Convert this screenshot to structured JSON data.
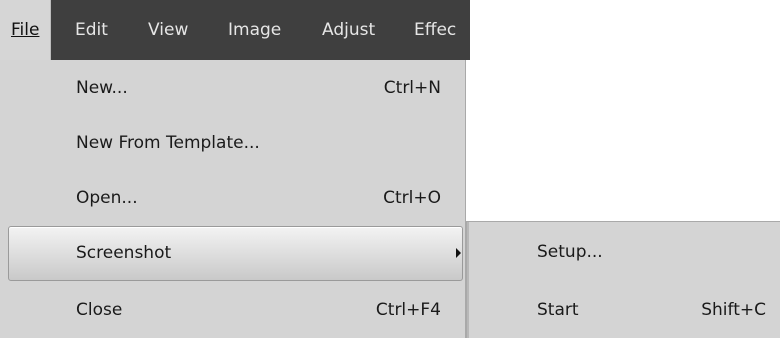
{
  "menubar": {
    "items": [
      {
        "label": "File",
        "underline": "F"
      },
      {
        "label": "Edit",
        "underline": "E"
      },
      {
        "label": "View",
        "underline": "V"
      },
      {
        "label": "Image",
        "underline": "I"
      },
      {
        "label": "Adjust",
        "underline": "A"
      },
      {
        "label": "Effec"
      }
    ],
    "active": "File"
  },
  "file_menu": {
    "items": [
      {
        "label": "New...",
        "shortcut": "Ctrl+N"
      },
      {
        "label": "New From Template...",
        "shortcut": ""
      },
      {
        "label": "Open...",
        "shortcut": "Ctrl+O"
      },
      {
        "label": "Screenshot",
        "shortcut": "",
        "has_submenu": true,
        "highlighted": true
      },
      {
        "label": "Close",
        "shortcut": "Ctrl+F4"
      }
    ]
  },
  "screenshot_submenu": {
    "items": [
      {
        "label": "Setup...",
        "shortcut": ""
      },
      {
        "label": "Start",
        "shortcut": "Shift+C"
      }
    ]
  },
  "colors": {
    "menubar_bg": "#3f3f3f",
    "menu_bg": "#d4d4d4",
    "menubar_text": "#e6e6e6",
    "menu_text": "#1a1a1a"
  },
  "icons": {
    "submenu_arrow": "chevron-right-icon"
  }
}
